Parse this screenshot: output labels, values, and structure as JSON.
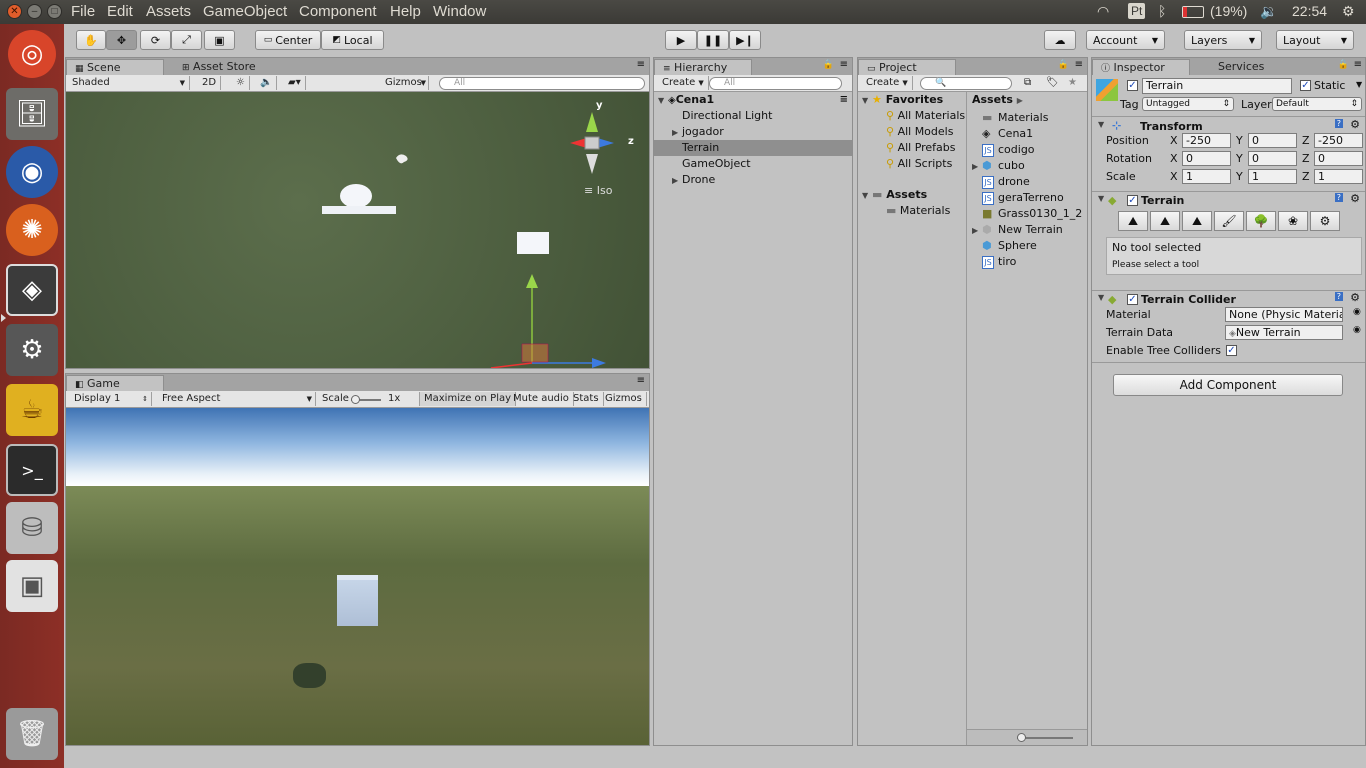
{
  "menubar": {
    "items": [
      "File",
      "Edit",
      "Assets",
      "GameObject",
      "Component",
      "Help",
      "Window"
    ],
    "battery": "(19%)",
    "clock": "22:54",
    "keyboard": "Pt"
  },
  "toolbar": {
    "center": "Center",
    "local": "Local",
    "account": "Account",
    "layers": "Layers",
    "layout": "Layout"
  },
  "scene": {
    "tabs": [
      "Scene",
      "Asset Store"
    ],
    "shading": "Shaded",
    "mode2d": "2D",
    "gizmos": "Gizmos",
    "search_placeholder": "All",
    "gizmo_axes": {
      "y": "y",
      "z": "z"
    },
    "iso": "Iso"
  },
  "game": {
    "tab": "Game",
    "display": "Display 1",
    "aspect": "Free Aspect",
    "scale_label": "Scale",
    "scale_value": "1x",
    "buttons": [
      "Maximize on Play",
      "Mute audio",
      "Stats",
      "Gizmos"
    ]
  },
  "hierarchy": {
    "tab": "Hierarchy",
    "create": "Create",
    "search_placeholder": "All",
    "scene_name": "Cena1",
    "items": [
      {
        "label": "Directional Light",
        "expand": false
      },
      {
        "label": "jogador",
        "expand": true
      },
      {
        "label": "Terrain",
        "expand": false,
        "selected": true
      },
      {
        "label": "GameObject",
        "expand": false
      },
      {
        "label": "Drone",
        "expand": true
      }
    ]
  },
  "project": {
    "tab": "Project",
    "create": "Create",
    "favorites_label": "Favorites",
    "favorites": [
      "All Materials",
      "All Models",
      "All Prefabs",
      "All Scripts"
    ],
    "assets_label": "Assets",
    "assets_children": [
      "Materials"
    ],
    "breadcrumb": "Assets",
    "files": [
      {
        "label": "Materials",
        "icon": "folder"
      },
      {
        "label": "Cena1",
        "icon": "unity"
      },
      {
        "label": "codigo",
        "icon": "script"
      },
      {
        "label": "cubo",
        "icon": "prefab",
        "expand": true
      },
      {
        "label": "drone",
        "icon": "script"
      },
      {
        "label": "geraTerreno",
        "icon": "script"
      },
      {
        "label": "Grass0130_1_2",
        "icon": "texture"
      },
      {
        "label": "New Terrain",
        "icon": "terrain",
        "expand": true
      },
      {
        "label": "Sphere",
        "icon": "prefab"
      },
      {
        "label": "tiro",
        "icon": "script"
      }
    ]
  },
  "inspector": {
    "tabs": [
      "Inspector",
      "Services"
    ],
    "object_name": "Terrain",
    "static_label": "Static",
    "tag_label": "Tag",
    "tag_value": "Untagged",
    "layer_label": "Layer",
    "layer_value": "Default",
    "transform": {
      "title": "Transform",
      "position_label": "Position",
      "rotation_label": "Rotation",
      "scale_label": "Scale",
      "axes": [
        "X",
        "Y",
        "Z"
      ],
      "position": [
        "-250",
        "0",
        "-250"
      ],
      "rotation": [
        "0",
        "0",
        "0"
      ],
      "scale": [
        "1",
        "1",
        "1"
      ]
    },
    "terrain": {
      "title": "Terrain",
      "no_tool": "No tool selected",
      "hint": "Please select a tool"
    },
    "collider": {
      "title": "Terrain Collider",
      "material_label": "Material",
      "material_value": "None (Physic Material",
      "data_label": "Terrain Data",
      "data_value": "New Terrain",
      "trees_label": "Enable Tree Colliders"
    },
    "add_component": "Add Component"
  },
  "colors": {
    "accent": "#e05d2b",
    "scene_bg": "#536645",
    "selection": "#8f8f8f",
    "launcher": "#8d2f26"
  }
}
